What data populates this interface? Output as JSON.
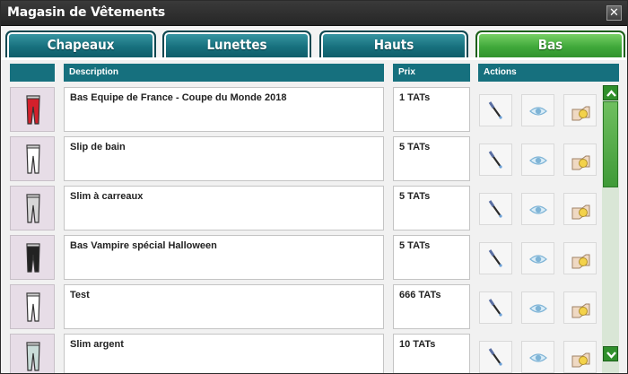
{
  "window": {
    "title": "Magasin de Vêtements",
    "close_symbol": "✕"
  },
  "tabs": [
    {
      "label": "Chapeaux",
      "active": false
    },
    {
      "label": "Lunettes",
      "active": false
    },
    {
      "label": "Hauts",
      "active": false
    },
    {
      "label": "Bas",
      "active": true
    }
  ],
  "columns": {
    "description": "Description",
    "price": "Prix",
    "actions": "Actions"
  },
  "items": [
    {
      "description": "Bas Equipe de France - Coupe du Monde 2018",
      "price": "1 TATs",
      "thumb_color": "#d3202b"
    },
    {
      "description": "Slip de bain",
      "price": "5 TATs",
      "thumb_color": "#ffffff"
    },
    {
      "description": "Slim à carreaux",
      "price": "5 TATs",
      "thumb_color": "#d6d6d6"
    },
    {
      "description": "Bas Vampire spécial Halloween",
      "price": "5 TATs",
      "thumb_color": "#222222"
    },
    {
      "description": "Test",
      "price": "666 TATs",
      "thumb_color": "#ffffff"
    },
    {
      "description": "Slim argent",
      "price": "10 TATs",
      "thumb_color": "#c9dcd8"
    }
  ],
  "icons": {
    "try": "eyedropper-icon",
    "preview": "eye-icon",
    "buy": "hand-coin-icon"
  },
  "colors": {
    "tab_teal": "#16707e",
    "tab_active_green": "#3fa83a",
    "header_teal": "#16707e"
  }
}
